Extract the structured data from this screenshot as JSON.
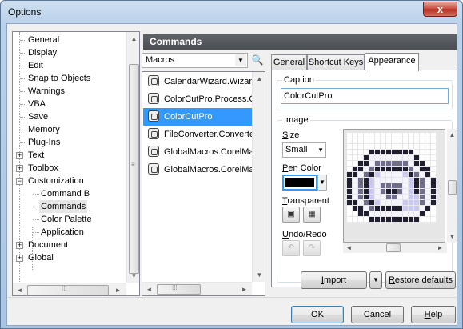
{
  "window": {
    "title": "Options",
    "close": "x"
  },
  "tree": {
    "items": [
      {
        "label": "General"
      },
      {
        "label": "Display"
      },
      {
        "label": "Edit"
      },
      {
        "label": "Snap to Objects"
      },
      {
        "label": "Warnings"
      },
      {
        "label": "VBA"
      },
      {
        "label": "Save"
      },
      {
        "label": "Memory"
      },
      {
        "label": "Plug-Ins"
      },
      {
        "label": "Text"
      },
      {
        "label": "Toolbox"
      },
      {
        "label": "Customization"
      },
      {
        "label": "Command B"
      },
      {
        "label": "Commands"
      },
      {
        "label": "Color Palette"
      },
      {
        "label": "Application"
      },
      {
        "label": "Document"
      },
      {
        "label": "Global"
      }
    ],
    "expanders": {
      "plus": "+",
      "minus": "−"
    },
    "scroll": {
      "up": "▲",
      "down": "▼",
      "left": "◄",
      "right": "►",
      "grip": "≡",
      "hgrip": "⁞⁞⁞"
    }
  },
  "commands": {
    "header": "Commands",
    "category_value": "Macros",
    "category_arrow": "▼",
    "find_icon": "🔍",
    "list": [
      {
        "label": "CalendarWizard.Wizard.C"
      },
      {
        "label": "ColorCutPro.Process.Col"
      },
      {
        "label": "ColorCutPro"
      },
      {
        "label": "FileConverter.Converter.S"
      },
      {
        "label": "GlobalMacros.CorelMacr"
      },
      {
        "label": "GlobalMacros.CorelMacr"
      }
    ],
    "selected_index": 2
  },
  "tabs": [
    {
      "label": "General"
    },
    {
      "label": "Shortcut Keys"
    },
    {
      "label": "Appearance"
    }
  ],
  "appearance": {
    "caption_label": "Caption",
    "caption_value": "ColorCutPro",
    "image_label": "Image",
    "size_label_u": "S",
    "size_label_rest": "ize",
    "size_value": "Small",
    "size_arrow": "▼",
    "pen_label_u": "P",
    "pen_label_rest": "en Color",
    "pen_arrow": "▼",
    "transparent_label_u": "T",
    "transparent_label_rest": "ransparent",
    "undo_label_u": "U",
    "undo_label_rest": "ndo/Redo",
    "transparent_btn1": "▣",
    "transparent_btn2": "▦",
    "undo_icon": "↶",
    "redo_icon": "↷",
    "scroll_up": "▲",
    "scroll_down": "▼",
    "scroll_left": "◄",
    "scroll_right": "►"
  },
  "buttons": {
    "import_u": "I",
    "import_rest": "mport",
    "import_arrow": "▼",
    "restore_u": "R",
    "restore_rest": "estore defaults",
    "ok": "OK",
    "cancel": "Cancel",
    "help_u": "H",
    "help_rest": "elp"
  },
  "colors": {
    "selection": "#3399ff",
    "header_bg": "#4f5357",
    "pen_color": "#000000"
  }
}
